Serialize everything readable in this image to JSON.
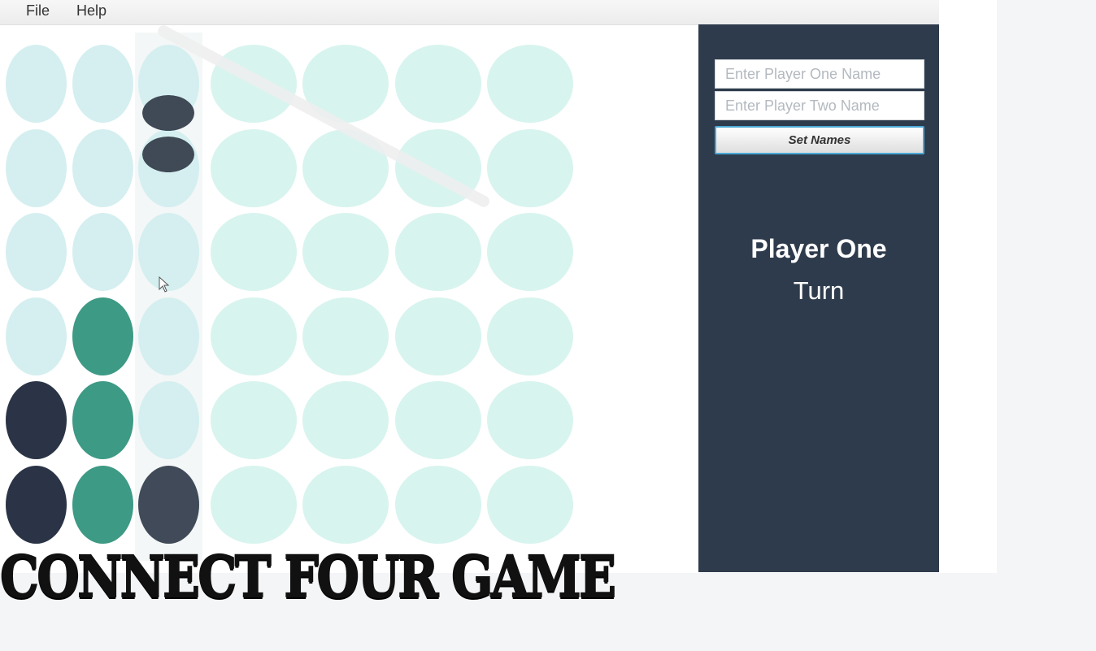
{
  "menu": {
    "items": [
      "File",
      "Help"
    ]
  },
  "board": {
    "columns": 7,
    "rows": 6,
    "colors": {
      "empty_slot": "#d8f4ee",
      "empty_slot_hover": "#d5eff0",
      "player_one": "#3d9a84",
      "player_two": "#2a3446",
      "dropping_piece": "#3f4a56"
    },
    "cells": [
      [
        "empty",
        "empty",
        "empty",
        "empty",
        "empty",
        "empty",
        "empty"
      ],
      [
        "empty",
        "empty",
        "empty",
        "empty",
        "empty",
        "empty",
        "empty"
      ],
      [
        "empty",
        "empty",
        "empty",
        "empty",
        "empty",
        "empty",
        "empty"
      ],
      [
        "empty",
        "player_one",
        "empty",
        "empty",
        "empty",
        "empty",
        "empty"
      ],
      [
        "player_two",
        "player_one",
        "empty",
        "empty",
        "empty",
        "empty",
        "empty"
      ],
      [
        "player_two",
        "player_one",
        "player_two",
        "empty",
        "empty",
        "empty",
        "empty"
      ]
    ],
    "hover_column": 2
  },
  "sidebar": {
    "player_one_placeholder": "Enter Player One Name",
    "player_two_placeholder": "Enter Player Two Name",
    "set_names_label": "Set Names",
    "current_player": "Player One",
    "turn_label": "Turn",
    "background": "#2e3b4c"
  },
  "banner": {
    "text": "CONNECT FOUR GAME"
  },
  "icons": {
    "cursor": "mouse-pointer-icon"
  }
}
